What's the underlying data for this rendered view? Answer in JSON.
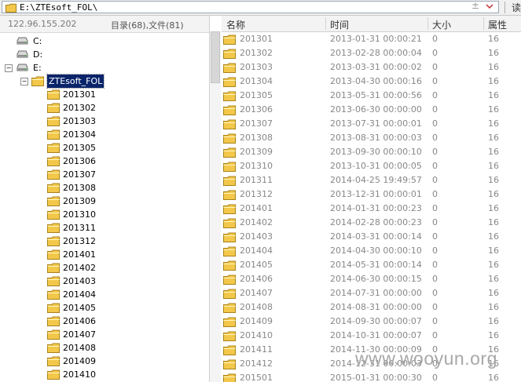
{
  "address_bar": {
    "path": "E:\\ZTEsoft_FOL\\",
    "read_label": "读"
  },
  "left_panel": {
    "ip": "122.96.155.202",
    "counts": "目录(68),文件(81)",
    "drives": [
      "C:",
      "D:",
      "E:"
    ],
    "root_folder": "ZTEsoft_FOL",
    "subfolders": [
      "201301",
      "201302",
      "201303",
      "201304",
      "201305",
      "201306",
      "201307",
      "201308",
      "201309",
      "201310",
      "201311",
      "201312",
      "201401",
      "201402",
      "201403",
      "201404",
      "201405",
      "201406",
      "201407",
      "201408",
      "201409",
      "201410"
    ]
  },
  "list": {
    "columns": [
      "名称",
      "时间",
      "大小",
      "属性"
    ],
    "rows": [
      {
        "name": "201301",
        "time": "2013-01-31 00:00:21",
        "size": "0",
        "attr": "16"
      },
      {
        "name": "201302",
        "time": "2013-02-28 00:00:04",
        "size": "0",
        "attr": "16"
      },
      {
        "name": "201303",
        "time": "2013-03-31 00:00:02",
        "size": "0",
        "attr": "16"
      },
      {
        "name": "201304",
        "time": "2013-04-30 00:00:16",
        "size": "0",
        "attr": "16"
      },
      {
        "name": "201305",
        "time": "2013-05-31 00:00:56",
        "size": "0",
        "attr": "16"
      },
      {
        "name": "201306",
        "time": "2013-06-30 00:00:00",
        "size": "0",
        "attr": "16"
      },
      {
        "name": "201307",
        "time": "2013-07-31 00:00:01",
        "size": "0",
        "attr": "16"
      },
      {
        "name": "201308",
        "time": "2013-08-31 00:00:03",
        "size": "0",
        "attr": "16"
      },
      {
        "name": "201309",
        "time": "2013-09-30 00:00:10",
        "size": "0",
        "attr": "16"
      },
      {
        "name": "201310",
        "time": "2013-10-31 00:00:05",
        "size": "0",
        "attr": "16"
      },
      {
        "name": "201311",
        "time": "2014-04-25 19:49:57",
        "size": "0",
        "attr": "16"
      },
      {
        "name": "201312",
        "time": "2013-12-31 00:00:01",
        "size": "0",
        "attr": "16"
      },
      {
        "name": "201401",
        "time": "2014-01-31 00:00:23",
        "size": "0",
        "attr": "16"
      },
      {
        "name": "201402",
        "time": "2014-02-28 00:00:23",
        "size": "0",
        "attr": "16"
      },
      {
        "name": "201403",
        "time": "2014-03-31 00:00:14",
        "size": "0",
        "attr": "16"
      },
      {
        "name": "201404",
        "time": "2014-04-30 00:00:10",
        "size": "0",
        "attr": "16"
      },
      {
        "name": "201405",
        "time": "2014-05-31 00:00:14",
        "size": "0",
        "attr": "16"
      },
      {
        "name": "201406",
        "time": "2014-06-30 00:00:15",
        "size": "0",
        "attr": "16"
      },
      {
        "name": "201407",
        "time": "2014-07-31 00:00:00",
        "size": "0",
        "attr": "16"
      },
      {
        "name": "201408",
        "time": "2014-08-31 00:00:00",
        "size": "0",
        "attr": "16"
      },
      {
        "name": "201409",
        "time": "2014-09-30 00:00:07",
        "size": "0",
        "attr": "16"
      },
      {
        "name": "201410",
        "time": "2014-10-31 00:00:07",
        "size": "0",
        "attr": "16"
      },
      {
        "name": "201411",
        "time": "2014-11-30 00:00:09",
        "size": "0",
        "attr": "16"
      },
      {
        "name": "201412",
        "time": "2014-12-31 00:00:03",
        "size": "0",
        "attr": "16"
      },
      {
        "name": "201501",
        "time": "2015-01-31 00:00:30",
        "size": "0",
        "attr": "16"
      }
    ]
  },
  "watermark": "www.wooyun.org",
  "colors": {
    "folder_yellow": "#f3c84a",
    "selection": "#0a246a",
    "header_bg": "#f3f3f3"
  }
}
